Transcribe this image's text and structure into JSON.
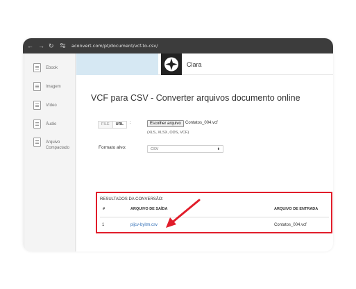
{
  "browser": {
    "url": "aconvert.com/pt/document/vcf-to-csv/",
    "nav_icons": [
      "arrow-left-icon",
      "arrow-right-icon",
      "reload-icon",
      "site-info-icon"
    ]
  },
  "sidebar": {
    "items": [
      {
        "label": "Ebook",
        "icon": "document-icon"
      },
      {
        "label": "Imagem",
        "icon": "image-icon"
      },
      {
        "label": "Vídeo",
        "icon": "video-icon"
      },
      {
        "label": "Áudio",
        "icon": "audio-icon"
      },
      {
        "label": "Arquivo Compactado",
        "icon": "archive-icon"
      }
    ]
  },
  "header": {
    "brand": "Clara",
    "logo_icon": "compass-star-icon"
  },
  "main": {
    "title": "VCF para CSV - Converter arquivos documento online",
    "source_tabs": [
      "FILE",
      "URL"
    ],
    "source_colon": ":",
    "file_button_label": "Escolher arquivo",
    "file_name": "Contatos_004.vcf",
    "file_hint": "(XLS, XLSX, ODS, VCF)",
    "format_label": "Formato alvo:",
    "format_value": "CSV"
  },
  "results": {
    "title": "RESULTADOS DA CONVERSÃO:",
    "columns": [
      "#",
      "ARQUIVO DE SAÍDA",
      "ARQUIVO DE ENTRADA"
    ],
    "rows": [
      {
        "num": "1",
        "output": "pijcv-byitm.csv",
        "input": "Contatos_004.vcf"
      }
    ]
  },
  "annotation": {
    "highlight_color": "#e11d2a",
    "arrow_icon": "red-arrow-icon"
  }
}
